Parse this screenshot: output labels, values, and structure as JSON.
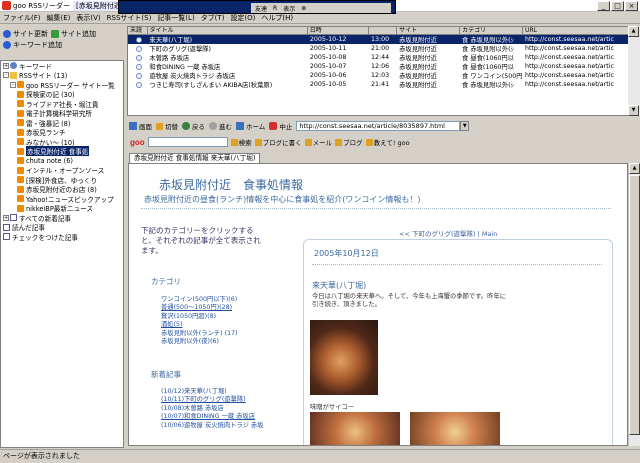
{
  "window": {
    "app_title": "goo RSSリーダー",
    "title_highlight": "[赤坂見附付近 食事処情報]",
    "overlay_items": [
      "友達",
      "R",
      "表示",
      "⊗"
    ],
    "minimize": "_",
    "maximize": "□",
    "close": "×"
  },
  "menu": [
    "ファイル(F)",
    "編集(E)",
    "表示(V)",
    "RSSサイト(S)",
    "記事一覧(L)",
    "タブ(T)",
    "設定(O)",
    "ヘルプ(H)"
  ],
  "left_toolbar": {
    "site_update": "サイト更新",
    "site_add": "サイト追加",
    "keyword_add": "キーワード追加"
  },
  "tree": [
    {
      "label": "キーワード",
      "icon": "key",
      "indent": 1,
      "exp": "+"
    },
    {
      "label": "RSSサイト (13)",
      "icon": "folder",
      "indent": 1,
      "exp": "-"
    },
    {
      "label": "goo RSSリーダー サイト一覧",
      "icon": "rss",
      "indent": 2,
      "exp": "-"
    },
    {
      "label": "探検家の記 (30)",
      "icon": "rss",
      "indent": 3
    },
    {
      "label": "ライブドア社長・堀江貴",
      "icon": "rss",
      "indent": 3
    },
    {
      "label": "電子計算機科学研究所",
      "icon": "rss",
      "indent": 3
    },
    {
      "label": "雷・強暴記 (8)",
      "icon": "rss",
      "indent": 3
    },
    {
      "label": "赤坂見ランチ",
      "icon": "rss",
      "indent": 3
    },
    {
      "label": "みなかい～ (10)",
      "icon": "rss",
      "indent": 3
    },
    {
      "label": "赤坂見附付近 食事処",
      "icon": "rss",
      "indent": 3,
      "selected": true
    },
    {
      "label": "chuta note (6)",
      "icon": "rss",
      "indent": 3
    },
    {
      "label": "インテル・オープンソース",
      "icon": "rss",
      "indent": 3
    },
    {
      "label": "[探検]外食店、ゆっくり",
      "icon": "rss",
      "indent": 3
    },
    {
      "label": "赤坂見附付近のお店 (8)",
      "icon": "rss",
      "indent": 3
    },
    {
      "label": "Yahoo!ニュースピックアップ",
      "icon": "rss",
      "indent": 3
    },
    {
      "label": "nikkeiBP最新ニュース",
      "icon": "rss",
      "indent": 3
    },
    {
      "label": "すべての新着記事",
      "icon": "doc",
      "indent": 1,
      "exp": "+"
    },
    {
      "label": "読んだ記事",
      "icon": "doc",
      "indent": 1
    },
    {
      "label": "チェックをつけた記事",
      "icon": "doc",
      "indent": 1
    }
  ],
  "list": {
    "headers": [
      "未読",
      "タイトル",
      "日時",
      "",
      "サイト",
      "カテゴリ",
      "URL"
    ],
    "rows": [
      {
        "title": "来天華(八丁堀)",
        "date": "2005-10-12",
        "time": "13:00",
        "site": "赤坂見附付近",
        "cat": "食",
        "cat2": "赤坂見附以外(ｼ",
        "url": "http://const.seesaa.net/artic",
        "selected": true
      },
      {
        "title": "下町のグリグ(遊撃隊)",
        "date": "2005-10-11",
        "time": "21:00",
        "site": "赤坂見附付近",
        "cat": "食",
        "cat2": "赤坂見附以外(ｼ",
        "url": "http://const.seesaa.net/artic"
      },
      {
        "title": "木曽路 赤坂店",
        "date": "2005-10-08",
        "time": "12:44",
        "site": "赤坂見附付近",
        "cat": "食",
        "cat2": "昼食(1060円以",
        "url": "http://const.seesaa.net/artic"
      },
      {
        "title": "和食DINING 一蔵 赤坂店",
        "date": "2005-10-07",
        "time": "12:06",
        "site": "赤坂見附付近",
        "cat": "食",
        "cat2": "昼食(1060円以",
        "url": "http://const.seesaa.net/artic"
      },
      {
        "title": "遊牧屋 炭火焼肉トラジ 赤坂店",
        "date": "2005-10-06",
        "time": "12:03",
        "site": "赤坂見附付近",
        "cat": "食",
        "cat2": "ワンコイン(500円",
        "url": "http://const.seesaa.net/artic"
      },
      {
        "title": "つきじ寿司(すしざんまい AKIBA店(秋葉原)",
        "date": "2005-10-05",
        "time": "21:41",
        "site": "赤坂見附付近",
        "cat": "食",
        "cat2": "赤坂見附以外(ｼ",
        "url": "http://const.seesaa.net/artic"
      }
    ]
  },
  "browser": {
    "screen": "画面",
    "cut": "切替",
    "back": "戻る",
    "forward": "進む",
    "home": "ホーム",
    "stop": "中止",
    "url": "http://const.seesaa.net/article/8035897.html"
  },
  "goo_bar": {
    "logo": "goo",
    "search_btn": "検索",
    "blog_write": "ブログに書く",
    "mail": "メール",
    "blog": "ブログ",
    "teach": "教えて! goo"
  },
  "tab": {
    "label": "赤坂見附付近 食事処情報 来天華(八丁堀)"
  },
  "page": {
    "blog_title": "赤坂見附付近　食事処情報",
    "blog_desc": "赤坂見附付近の昼食(ランチ)情報を中心に食事処を紹介(ワンコイン情報も！)",
    "intro": "下記のカテゴリーをクリックすると、それぞれの記事が全て表示されます。",
    "prev_link": "<< 下町のグリグ(遊撃隊) | Main",
    "category_head": "カテゴリ",
    "categories": [
      "ワンコイン(500円以下)(6)",
      "普通(500～1050円)(28)",
      "贅沢(1050円超)(8)",
      "酒処(5)",
      "赤坂見附以外(ランチ) (17)",
      "赤坂見附以外(夜)(6)"
    ],
    "recent_head": "新着記事",
    "recent": [
      "(10/12)来天華(八丁堀)",
      "(10/11)下町のグリグ(遊撃隊)",
      "(10/08)木曽路 赤坂店",
      "(10/07)和食DINING 一蔵 赤坂店",
      "(10/06)遊牧屋 炭火焼肉トラジ 赤坂"
    ],
    "post_date": "2005年10月12日",
    "post_title": "来天華(八丁堀)",
    "post_body": "今日は八丁堀の来天華へ。そして、今年も上海蟹の季節です。昨年に引き続き、頂きました。",
    "photo_caption": "味噌がサイコー"
  },
  "status": "ページが表示されました"
}
